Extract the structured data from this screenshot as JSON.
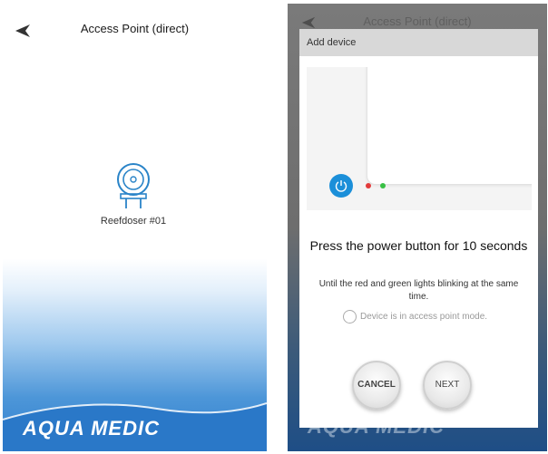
{
  "left_screen": {
    "title": "Access Point (direct)",
    "device": {
      "name": "Reefdoser #01",
      "icon": "doser-pump-icon"
    },
    "brand": "AQUA MEDIC"
  },
  "right_screen": {
    "background_title": "Access Point (direct)",
    "dialog": {
      "header": "Add device",
      "heading": "Press the power button for 10 seconds",
      "instruction": "Until the red and green lights blinking at the same time.",
      "checkbox_label": "Device is in access point mode.",
      "checkbox_checked": false,
      "cancel_label": "CANCEL",
      "next_label": "NEXT"
    },
    "brand": "AQUA MEDIC"
  },
  "colors": {
    "accent": "#1b8fd9",
    "led_red": "#e23b3b",
    "led_green": "#39c045",
    "bottom_blue": "#2f7fcf"
  }
}
